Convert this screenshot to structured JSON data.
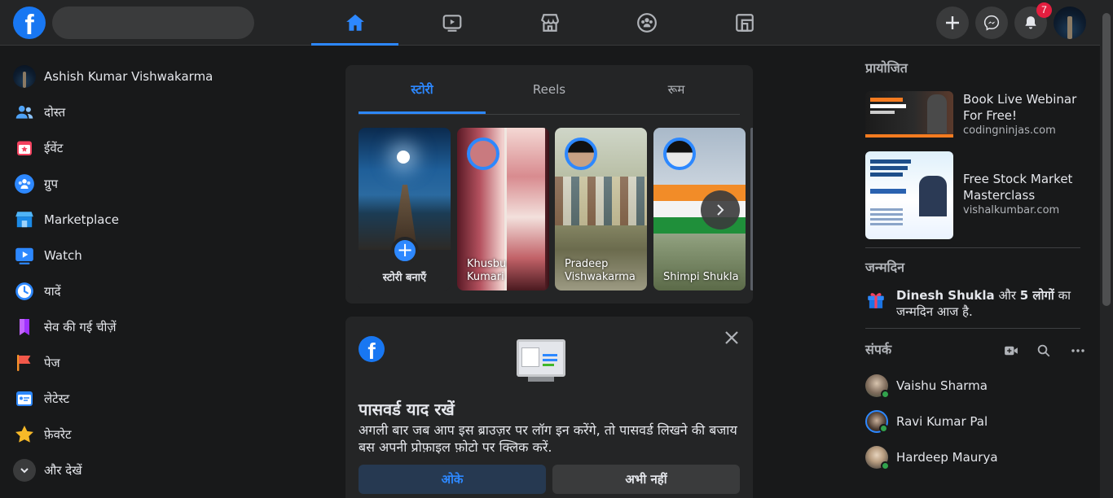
{
  "topbar": {
    "logo": "f",
    "search_placeholder": "",
    "nav": [
      {
        "icon": "home-icon",
        "active": true
      },
      {
        "icon": "watch-icon",
        "active": false
      },
      {
        "icon": "marketplace-icon",
        "active": false
      },
      {
        "icon": "groups-icon",
        "active": false
      },
      {
        "icon": "gaming-icon",
        "active": false
      }
    ],
    "notifications_count": "7"
  },
  "sidebar": {
    "items": [
      {
        "label": "Ashish Kumar Vishwakarma",
        "icon": "profile-avatar"
      },
      {
        "label": "दोस्त",
        "icon": "friends-icon"
      },
      {
        "label": "ईवेंट",
        "icon": "events-icon"
      },
      {
        "label": "ग्रुप",
        "icon": "groups-icon"
      },
      {
        "label": "Marketplace",
        "icon": "marketplace-icon"
      },
      {
        "label": "Watch",
        "icon": "watch-icon"
      },
      {
        "label": "यादें",
        "icon": "memories-icon"
      },
      {
        "label": "सेव की गई चीज़ें",
        "icon": "saved-icon"
      },
      {
        "label": "पेज",
        "icon": "pages-icon"
      },
      {
        "label": "लेटेस्ट",
        "icon": "latest-icon"
      },
      {
        "label": "फ़ेवरेट",
        "icon": "favorites-icon"
      },
      {
        "label": "और देखें",
        "icon": "chevron-down-icon"
      }
    ]
  },
  "stories": {
    "tabs": [
      {
        "label": "स्टोरी",
        "active": true
      },
      {
        "label": "Reels",
        "active": false
      },
      {
        "label": "रूम",
        "active": false
      }
    ],
    "create_label": "स्टोरी बनाएँ",
    "items": [
      {
        "name": "Khusbu Kumari"
      },
      {
        "name": "Pradeep Vishwakarma"
      },
      {
        "name": "Shimpi Shukla"
      }
    ]
  },
  "password_card": {
    "title": "पासवर्ड याद रखें",
    "description": "अगली बार जब आप इस ब्राउज़र पर लॉग इन करेंगे, तो पासवर्ड लिखने की बजाय बस अपनी प्रोफ़ाइल फ़ोटो पर क्लिक करें.",
    "ok_label": "ओके",
    "later_label": "अभी नहीं"
  },
  "right": {
    "sponsored_title": "प्रायोजित",
    "ads": [
      {
        "title": "Book Live Webinar For Free!",
        "url": "codingninjas.com"
      },
      {
        "title": "Free Stock Market Masterclass",
        "url": "vishalkumbar.com"
      }
    ],
    "birthdays_title": "जन्मदिन",
    "birthday_name": "Dinesh Shukla",
    "birthday_and": "और",
    "birthday_count": "5 लोगों",
    "birthday_ka": "का",
    "birthday_rest": "जन्मदिन आज है.",
    "contacts_title": "संपर्क",
    "contacts": [
      {
        "name": "Vaishu Sharma"
      },
      {
        "name": "Ravi Kumar Pal"
      },
      {
        "name": "Hardeep Maurya"
      }
    ]
  },
  "colors": {
    "accent": "#2d88ff",
    "brand": "#1877f2",
    "badge": "#e41e3f",
    "online": "#31a24c"
  }
}
